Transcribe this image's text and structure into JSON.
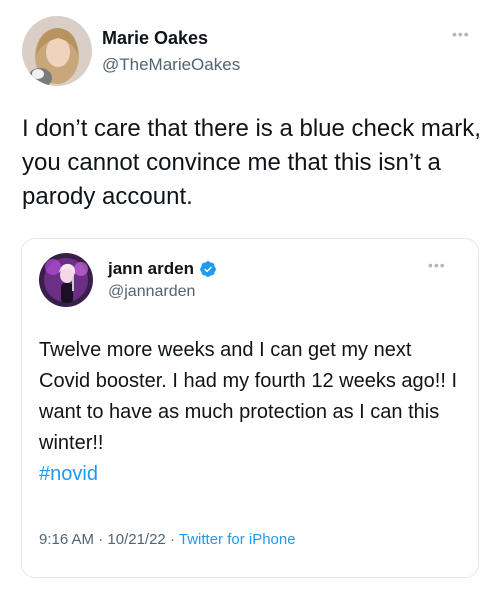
{
  "outer_tweet": {
    "author_name": "Marie Oakes",
    "author_handle": "@TheMarieOakes",
    "more_icon": "more-options-icon",
    "text": "I don’t care that there is a blue check mark, you cannot convince me that this isn’t a parody account."
  },
  "quoted_tweet": {
    "author_name": "jann arden",
    "author_handle": "@jannarden",
    "verified_icon": "verified-badge-icon",
    "more_icon": "more-options-icon",
    "text": "Twelve more weeks and I can get my next Covid  booster. I had my fourth 12 weeks ago!! I want to have as much protection as I can this winter!!",
    "hashtag": "#novid",
    "time": "9:16 AM",
    "date": "10/21/22",
    "source": "Twitter for iPhone",
    "separator": "·"
  },
  "colors": {
    "link": "#1d9bf0",
    "secondary_text": "#536471",
    "border": "#e1e8ed"
  }
}
